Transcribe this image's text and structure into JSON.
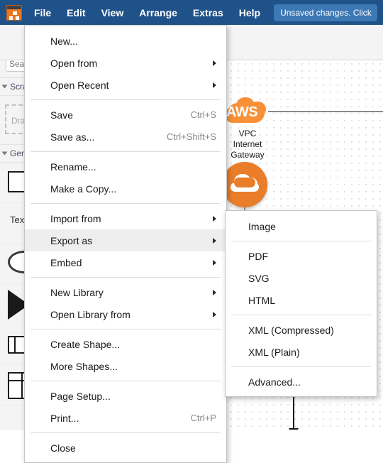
{
  "app": {
    "logo_icon": "drawio-logo-icon",
    "menubar": [
      {
        "label": "File",
        "name": "menu-file",
        "active": true
      },
      {
        "label": "Edit",
        "name": "menu-edit",
        "active": false
      },
      {
        "label": "View",
        "name": "menu-view",
        "active": false
      },
      {
        "label": "Arrange",
        "name": "menu-arrange",
        "active": false
      },
      {
        "label": "Extras",
        "name": "menu-extras",
        "active": false
      },
      {
        "label": "Help",
        "name": "menu-help",
        "active": false
      }
    ],
    "unsaved_badge": "Unsaved changes. Click",
    "colors": {
      "menubar_bg": "#20528a",
      "badge_bg": "#3c78b4",
      "accent_orange": "#f79037",
      "node_orange": "#ea7d2a",
      "highlight_gray": "#eeeeee",
      "panel_bg": "#f4f4f4"
    }
  },
  "toolbar": {
    "items": [
      {
        "name": "bring-to-front-icon"
      },
      {
        "name": "send-to-back-icon"
      },
      {
        "name": "fill-color-icon"
      },
      {
        "name": "line-color-icon"
      },
      {
        "name": "shadow-icon"
      }
    ]
  },
  "sidebar": {
    "format_panel_toggle": "format-panel-icon",
    "search": {
      "placeholder": "Search Shapes",
      "value": ""
    },
    "sections": [
      {
        "label": "Scratchpad",
        "name": "sidebar-section-scratchpad"
      },
      {
        "label": "General",
        "name": "sidebar-section-general"
      }
    ],
    "scratchpad_hint": "Drag",
    "shapes": [
      {
        "name": "shape-rectangle"
      },
      {
        "name": "shape-text",
        "label": "Text"
      },
      {
        "name": "shape-ellipse"
      },
      {
        "name": "shape-triangle"
      },
      {
        "name": "shape-process"
      },
      {
        "name": "shape-table"
      }
    ]
  },
  "file_menu": {
    "items": [
      {
        "label": "New...",
        "name": "menu-item-new",
        "shortcut": "",
        "submenu": false,
        "sep_after": false
      },
      {
        "label": "Open from",
        "name": "menu-item-open-from",
        "shortcut": "",
        "submenu": true,
        "sep_after": false
      },
      {
        "label": "Open Recent",
        "name": "menu-item-open-recent",
        "shortcut": "",
        "submenu": true,
        "sep_after": true
      },
      {
        "label": "Save",
        "name": "menu-item-save",
        "shortcut": "Ctrl+S",
        "submenu": false,
        "sep_after": false
      },
      {
        "label": "Save as...",
        "name": "menu-item-save-as",
        "shortcut": "Ctrl+Shift+S",
        "submenu": false,
        "sep_after": true
      },
      {
        "label": "Rename...",
        "name": "menu-item-rename",
        "shortcut": "",
        "submenu": false,
        "sep_after": false
      },
      {
        "label": "Make a Copy...",
        "name": "menu-item-make-a-copy",
        "shortcut": "",
        "submenu": false,
        "sep_after": true
      },
      {
        "label": "Import from",
        "name": "menu-item-import-from",
        "shortcut": "",
        "submenu": true,
        "sep_after": false
      },
      {
        "label": "Export as",
        "name": "menu-item-export-as",
        "shortcut": "",
        "submenu": true,
        "sep_after": false,
        "highlighted": true
      },
      {
        "label": "Embed",
        "name": "menu-item-embed",
        "shortcut": "",
        "submenu": true,
        "sep_after": true
      },
      {
        "label": "New Library",
        "name": "menu-item-new-library",
        "shortcut": "",
        "submenu": true,
        "sep_after": false
      },
      {
        "label": "Open Library from",
        "name": "menu-item-open-library-from",
        "shortcut": "",
        "submenu": true,
        "sep_after": true
      },
      {
        "label": "Create Shape...",
        "name": "menu-item-create-shape",
        "shortcut": "",
        "submenu": false,
        "sep_after": false
      },
      {
        "label": "More Shapes...",
        "name": "menu-item-more-shapes",
        "shortcut": "",
        "submenu": false,
        "sep_after": true
      },
      {
        "label": "Page Setup...",
        "name": "menu-item-page-setup",
        "shortcut": "",
        "submenu": false,
        "sep_after": false
      },
      {
        "label": "Print...",
        "name": "menu-item-print",
        "shortcut": "Ctrl+P",
        "submenu": false,
        "sep_after": true
      },
      {
        "label": "Close",
        "name": "menu-item-close",
        "shortcut": "",
        "submenu": false,
        "sep_after": false
      }
    ]
  },
  "export_submenu": {
    "items": [
      {
        "label": "Image",
        "name": "submenu-item-image",
        "sep_after": true
      },
      {
        "label": "PDF",
        "name": "submenu-item-pdf",
        "sep_after": false
      },
      {
        "label": "SVG",
        "name": "submenu-item-svg",
        "sep_after": false
      },
      {
        "label": "HTML",
        "name": "submenu-item-html",
        "sep_after": true
      },
      {
        "label": "XML (Compressed)",
        "name": "submenu-item-xml-compressed",
        "sep_after": false
      },
      {
        "label": "XML (Plain)",
        "name": "submenu-item-xml-plain",
        "sep_after": true
      },
      {
        "label": "Advanced...",
        "name": "submenu-item-advanced",
        "sep_after": false
      }
    ]
  },
  "canvas": {
    "aws_cloud_label": "AWS",
    "vpc_caption": "VPC\nInternet\nGateway",
    "vpc_caption_lines": [
      "VPC",
      "Internet",
      "Gateway"
    ],
    "cloud_node_icon": "cloud-icon"
  }
}
